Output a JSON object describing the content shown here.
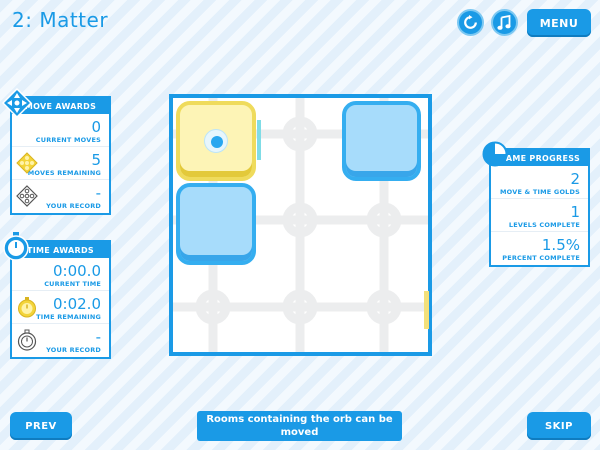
{
  "level": {
    "title": "2: Matter"
  },
  "top_bar": {
    "restart_icon": "restart-icon",
    "music_icon": "music-note-icon",
    "menu_label": "MENU"
  },
  "move_awards": {
    "title": "MOVE AWARDS",
    "current_moves": {
      "value": "0",
      "label": "CURRENT MOVES"
    },
    "moves_remaining": {
      "value": "5",
      "label": "MOVES REMAINING",
      "icon": "gold-medal-icon"
    },
    "record": {
      "value": "-",
      "label": "YOUR RECORD",
      "icon": "outline-medal-icon"
    }
  },
  "time_awards": {
    "title": "TIME AWARDS",
    "current_time": {
      "value": "0:00.0",
      "label": "CURRENT TIME"
    },
    "time_remaining": {
      "value": "0:02.0",
      "label": "TIME REMAINING",
      "icon": "gold-stopwatch-icon"
    },
    "record": {
      "value": "-",
      "label": "YOUR RECORD",
      "icon": "outline-stopwatch-icon"
    }
  },
  "game_progress": {
    "title": "GAME PROGRESS",
    "golds": {
      "value": "2",
      "label": "MOVE & TIME GOLDS"
    },
    "levels": {
      "value": "1",
      "label": "LEVELS COMPLETE"
    },
    "percent": {
      "value": "1.5%",
      "label": "PERCENT COMPLETE"
    }
  },
  "board": {
    "rooms": [
      {
        "color": "yellow",
        "has_orb": true
      },
      {
        "color": "blue",
        "has_orb": false
      },
      {
        "color": "blue",
        "has_orb": false
      }
    ]
  },
  "bottom": {
    "prev_label": "PREV",
    "skip_label": "SKIP",
    "hint": "Rooms containing the orb can be moved"
  },
  "colors": {
    "primary": "#1a9ae6",
    "yellow_room": "#fdf4b6",
    "blue_room": "#a7dcfb"
  }
}
